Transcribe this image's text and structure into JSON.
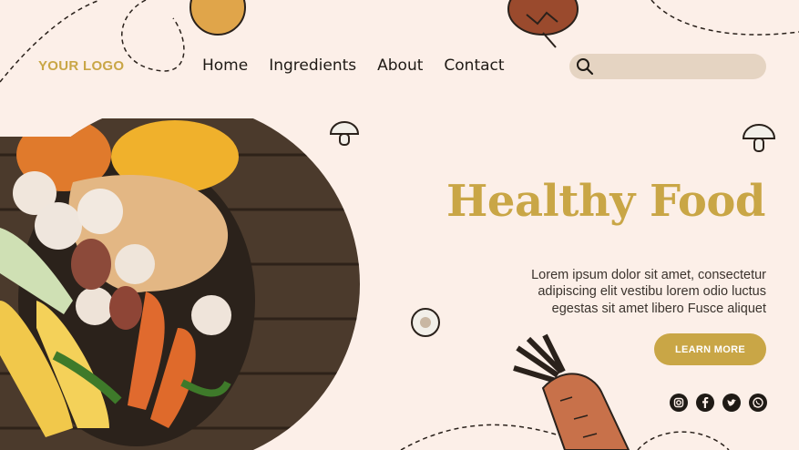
{
  "header": {
    "logo": "YOUR LOGO",
    "nav": [
      {
        "label": "Home"
      },
      {
        "label": "Ingredients"
      },
      {
        "label": "About"
      },
      {
        "label": "Contact"
      }
    ],
    "search": {
      "placeholder": ""
    }
  },
  "hero": {
    "title": "Healthy Food",
    "text": "Lorem ipsum dolor sit amet, consectetur adipiscing elit vestibu lorem odio luctus egestas sit amet libero Fusce aliquet",
    "button_label": "LEARN MORE"
  },
  "social": [
    {
      "icon": "instagram-icon"
    },
    {
      "icon": "facebook-icon"
    },
    {
      "icon": "twitter-icon"
    },
    {
      "icon": "whatsapp-icon"
    }
  ],
  "colors": {
    "background": "#fcefe8",
    "accent": "#c9a646",
    "text": "#1f1a15",
    "search_bg": "#e5d4c2"
  }
}
